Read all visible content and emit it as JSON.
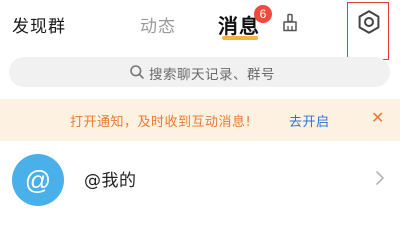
{
  "header": {
    "discover_label": "发现群",
    "tabs": [
      {
        "label": "动态",
        "active": false
      },
      {
        "label": "消息",
        "active": true,
        "badge": "6"
      }
    ],
    "clean_icon": "broom-icon",
    "settings_icon": "gear-icon"
  },
  "search": {
    "placeholder": "搜索聊天记录、群号",
    "icon": "search-icon"
  },
  "notice": {
    "text": "打开通知，及时收到互动消息!",
    "action_label": "去开启",
    "close_icon": "close-icon"
  },
  "list": {
    "items": [
      {
        "avatar_glyph": "@",
        "label": "@我的",
        "icon": "chevron-right-icon"
      }
    ]
  },
  "colors": {
    "accent": "#f3b33d",
    "badge": "#ef4a3b",
    "notice_bg": "#fdf1e2",
    "notice_text": "#ea7a33",
    "link": "#2c72d8",
    "avatar": "#4ab0ea",
    "highlight_box": "#e23b3b"
  }
}
